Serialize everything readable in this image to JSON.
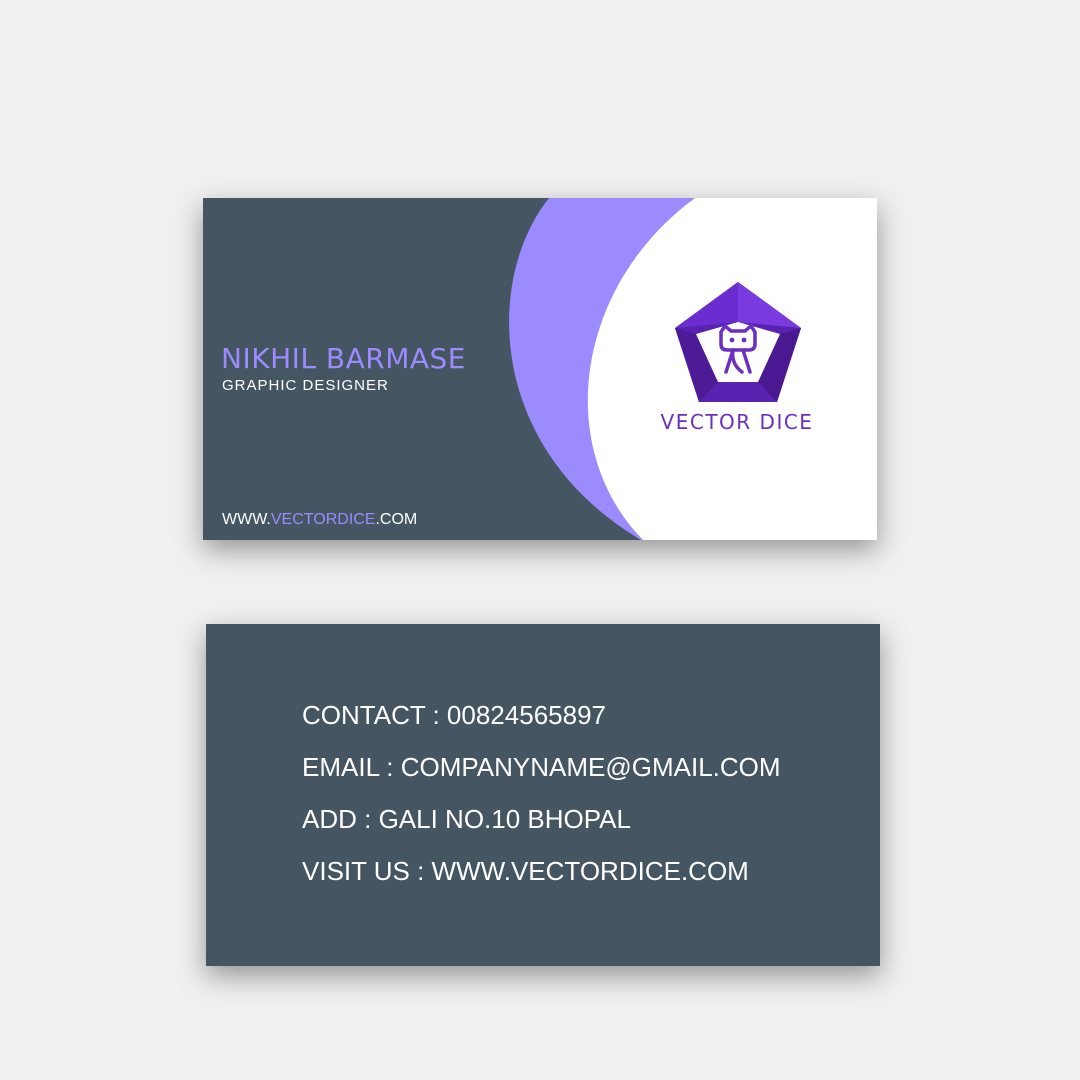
{
  "colors": {
    "background": "#f0f0f0",
    "card_slate": "#455561",
    "accent_lavender": "#9b8bff",
    "brand_purple": "#6a2fc0",
    "white": "#ffffff"
  },
  "front": {
    "name": "NIKHIL BARMASE",
    "job_title": "GRAPHIC DESIGNER",
    "website": {
      "prefix": "WWW.",
      "highlight": "VECTORDICE",
      "suffix": ".COM"
    },
    "logo": {
      "icon": "pentagon-cat-logo-icon",
      "brand_name": "VECTOR DICE"
    }
  },
  "back": {
    "lines": [
      "CONTACT : 00824565897",
      "EMAIL : COMPANYNAME@GMAIL.COM",
      "ADD : GALI NO.10 BHOPAL",
      "VISIT US : WWW.VECTORDICE.COM"
    ]
  }
}
